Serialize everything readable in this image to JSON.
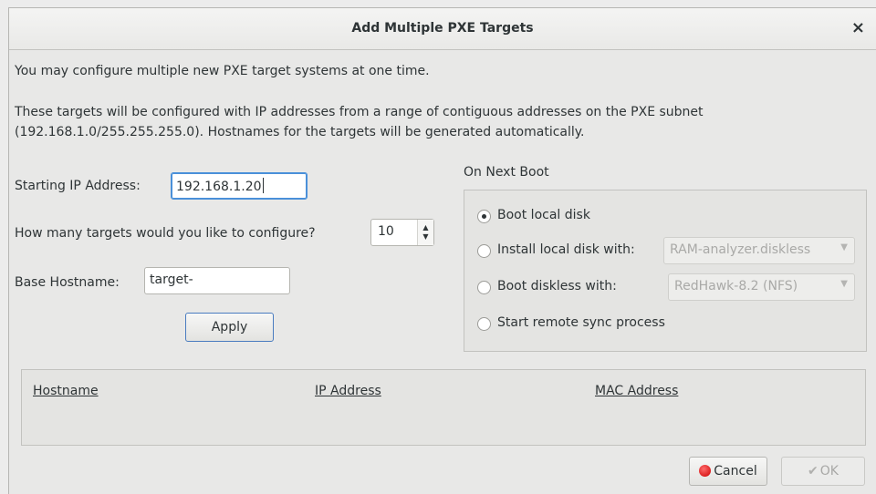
{
  "window": {
    "title": "Add Multiple PXE Targets",
    "close_glyph": "×"
  },
  "intro": {
    "line1": "You may configure multiple new PXE target systems at one time.",
    "line2": "These targets will be configured with IP addresses from a range of contiguous addresses on the PXE subnet",
    "line3": "(192.168.1.0/255.255.255.0).  Hostnames for the targets will be generated automatically."
  },
  "form": {
    "start_ip_label": "Starting IP Address:",
    "start_ip_value": "192.168.1.20",
    "count_label": "How many targets would you like to configure?",
    "count_value": "10",
    "hostname_label": "Base Hostname:",
    "hostname_value": "target-",
    "apply_label": "Apply"
  },
  "next_boot": {
    "title": "On Next Boot",
    "options": [
      {
        "label": "Boot local disk",
        "checked": true
      },
      {
        "label": "Install local disk with:",
        "checked": false,
        "combo": "RAM-analyzer.diskless"
      },
      {
        "label": "Boot diskless with:",
        "checked": false,
        "combo": "RedHawk-8.2 (NFS)"
      },
      {
        "label": "Start remote sync process",
        "checked": false
      }
    ]
  },
  "table": {
    "columns": [
      "Hostname",
      "IP Address",
      "MAC Address"
    ]
  },
  "footer": {
    "cancel_label": "Cancel",
    "ok_label": "OK"
  },
  "icons": {
    "cancel": "cancel-icon",
    "ok": "ok-icon",
    "spin": "spin-arrows-icon",
    "combo_arrow": "chevron-down-icon"
  },
  "colors": {
    "focus": "#4a90d9",
    "cancel_red": "#cc0000",
    "background": "#e8e8e7"
  }
}
